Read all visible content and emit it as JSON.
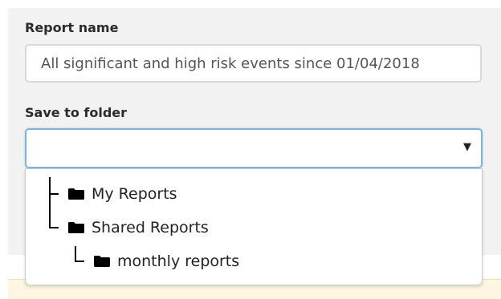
{
  "report_name": {
    "label": "Report name",
    "value": "All significant and high risk events since 01/04/2018"
  },
  "save_to_folder": {
    "label": "Save to folder",
    "selected": "",
    "caret": "▼",
    "options": [
      {
        "label": "My Reports",
        "icon": "folder-icon"
      },
      {
        "label": "Shared Reports",
        "icon": "folder-icon"
      },
      {
        "label": "monthly reports",
        "icon": "folder-icon"
      }
    ]
  }
}
